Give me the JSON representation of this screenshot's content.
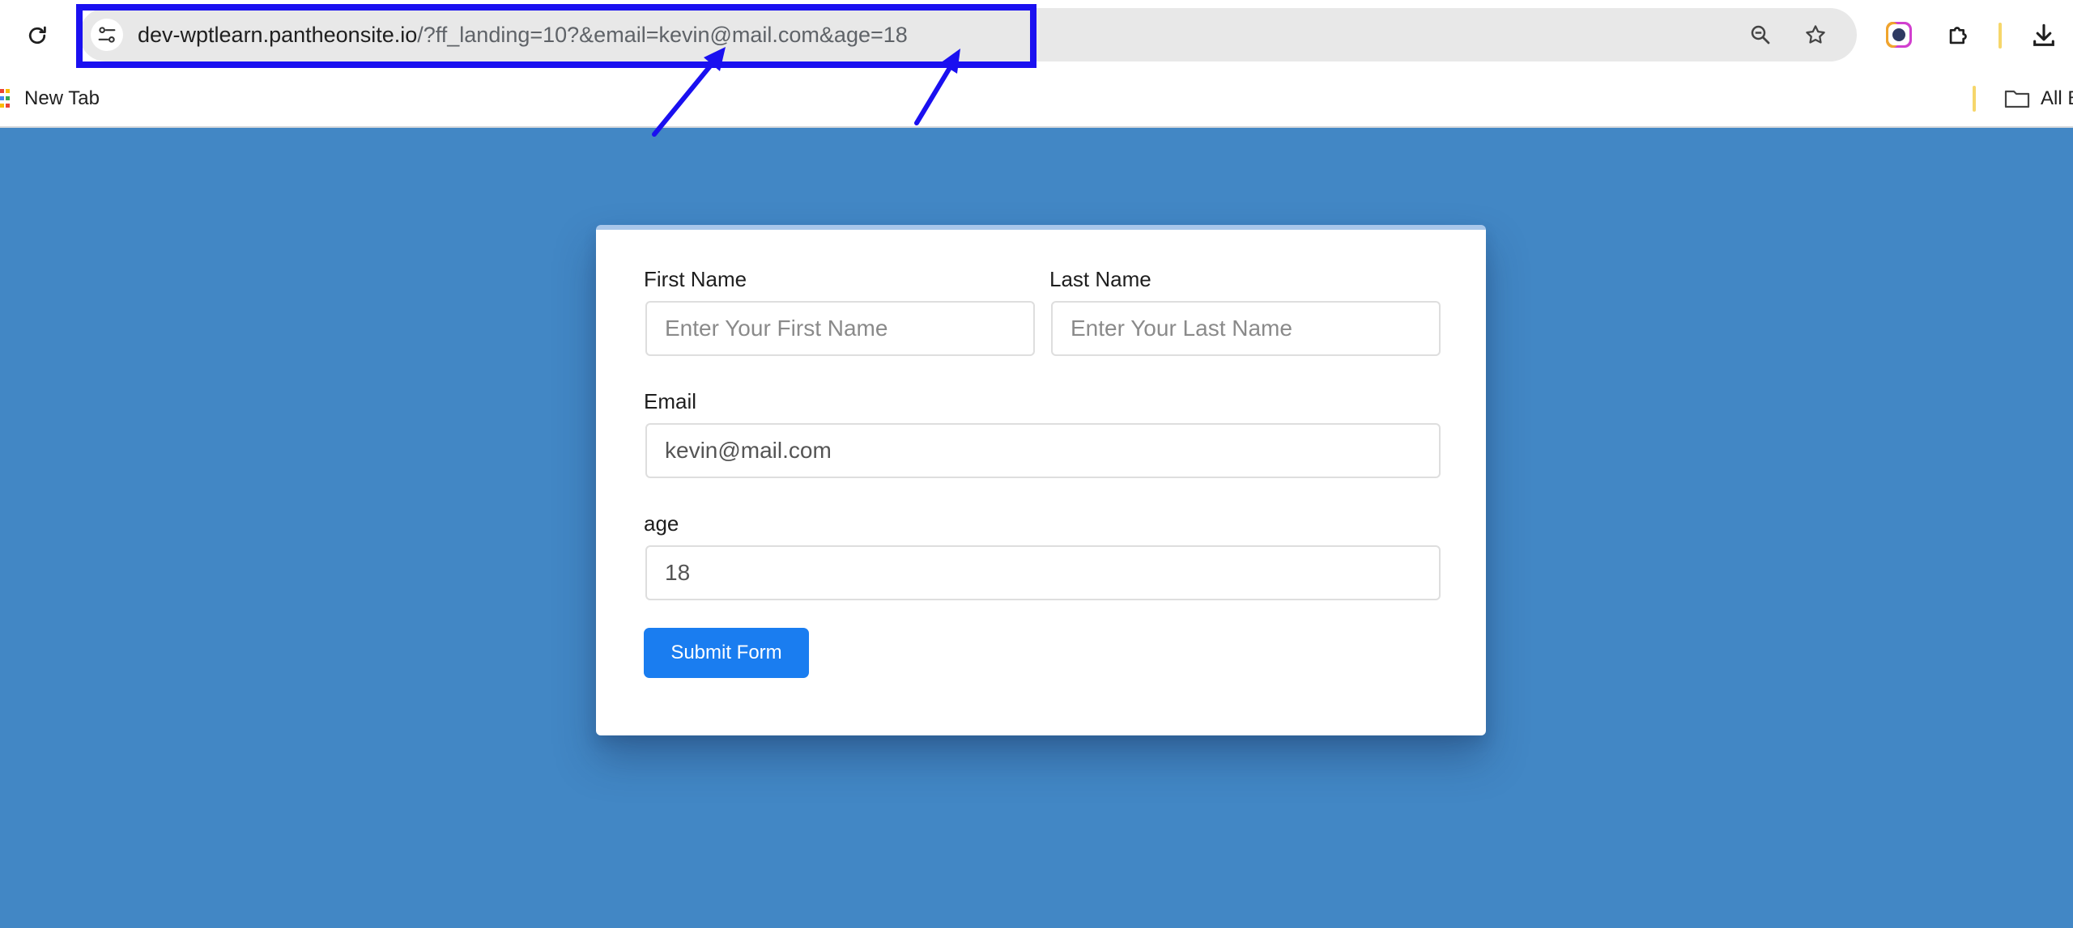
{
  "browser": {
    "url_host": "dev-wptlearn.pantheonsite.io",
    "url_rest": "/?ff_landing=10?&email=kevin@mail.com&age=18",
    "bookmarks": {
      "new_tab": "New Tab",
      "all_bookmarks": "All B"
    }
  },
  "form": {
    "first_name_label": "First Name",
    "first_name_placeholder": "Enter Your First Name",
    "first_name_value": "",
    "last_name_label": "Last Name",
    "last_name_placeholder": "Enter Your Last Name",
    "last_name_value": "",
    "email_label": "Email",
    "email_value": "kevin@mail.com",
    "age_label": "age",
    "age_value": "18",
    "submit_label": "Submit Form"
  },
  "colors": {
    "page_background": "#4287c5",
    "annotation": "#1a10f0",
    "submit_button": "#1a7df0"
  }
}
